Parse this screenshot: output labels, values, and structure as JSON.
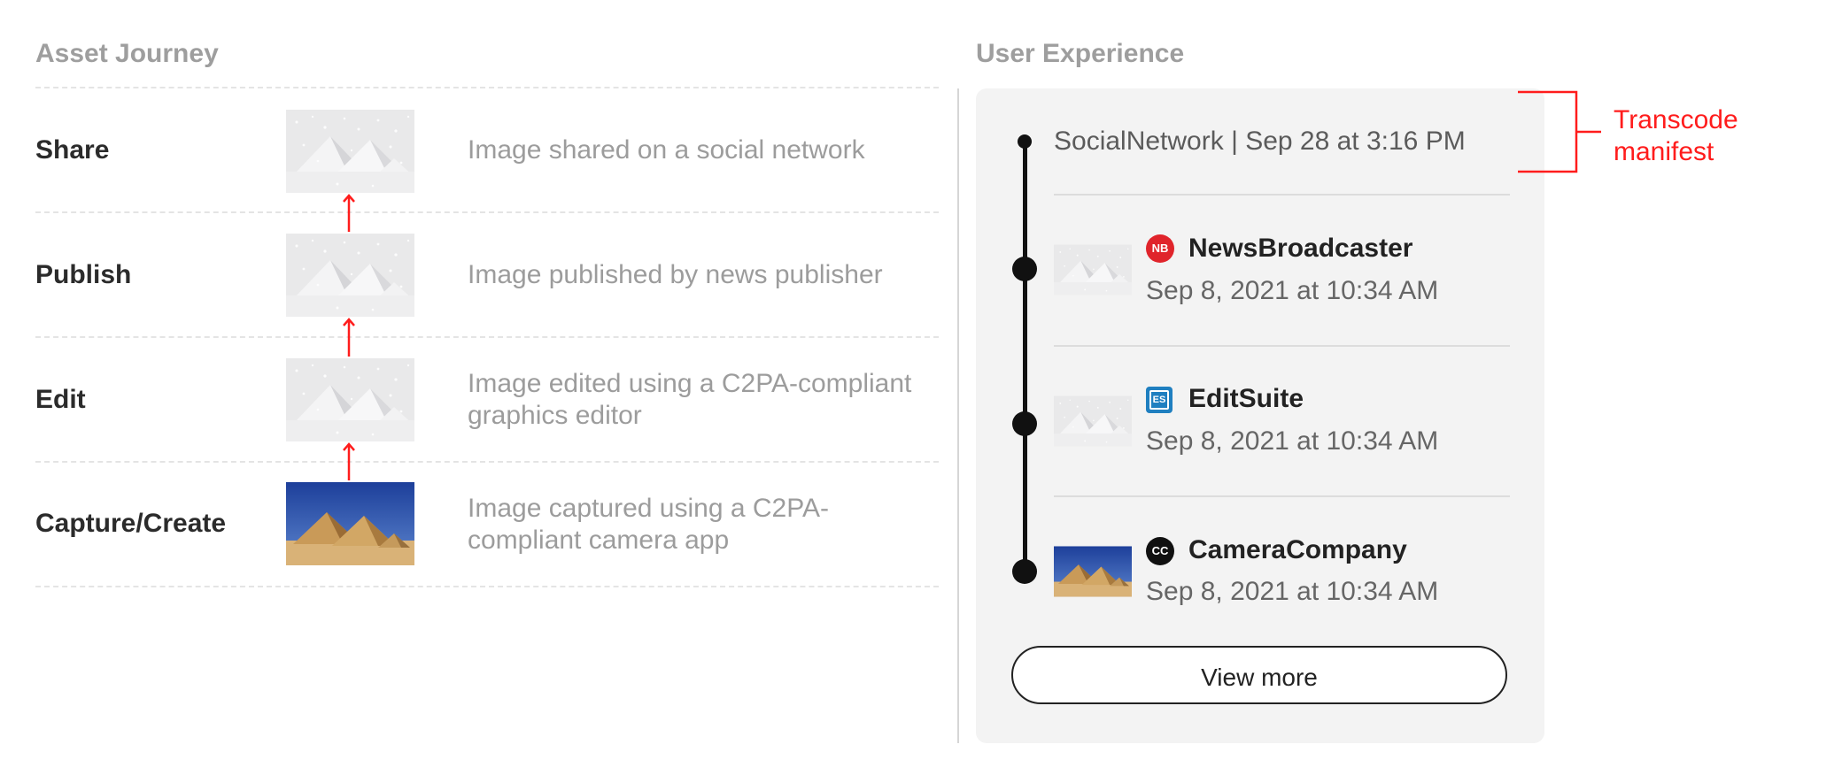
{
  "left": {
    "title": "Asset Journey",
    "stages": [
      {
        "label": "Share",
        "description": "Image shared on a social network",
        "thumbnail": "snowy-pyramids"
      },
      {
        "label": "Publish",
        "description": "Image published by news publisher",
        "thumbnail": "snowy-pyramids"
      },
      {
        "label": "Edit",
        "description": "Image edited using a C2PA-compliant graphics editor",
        "thumbnail": "snowy-pyramids"
      },
      {
        "label": "Capture/Create",
        "description": "Image captured using a C2PA-compliant camera app",
        "thumbnail": "desert-pyramids"
      }
    ],
    "arrow_color": "#ff1c1c"
  },
  "right": {
    "title": "User Experience",
    "top_entry": "SocialNetwork | Sep 28 at 3:16 PM",
    "entries": [
      {
        "name": "NewsBroadcaster",
        "date": "Sep 8, 2021 at 10:34 AM",
        "badge": "NB",
        "badge_color": "#e0242b",
        "thumbnail": "snowy-pyramids"
      },
      {
        "name": "EditSuite",
        "date": "Sep 8, 2021 at 10:34 AM",
        "badge": "ES",
        "badge_color": "#1f7fc0",
        "thumbnail": "snowy-pyramids"
      },
      {
        "name": "CameraCompany",
        "date": "Sep 8, 2021 at 10:34 AM",
        "badge": "CC",
        "badge_color": "#111111",
        "thumbnail": "desert-pyramids"
      }
    ],
    "button_label": "View more"
  },
  "annotation": {
    "text": "Transcode manifest",
    "color": "#ff1c1c"
  }
}
